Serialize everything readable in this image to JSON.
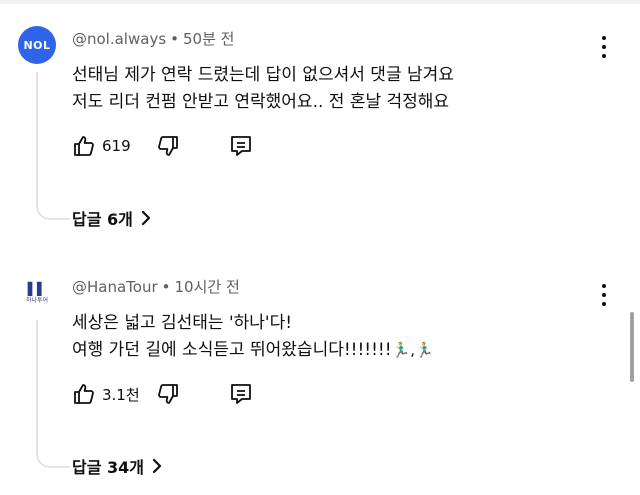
{
  "comments": [
    {
      "avatar_text": "NOL",
      "author": "@nol.always",
      "time": "50분 전",
      "separator": "•",
      "lines": [
        "선태님 제가 연락 드렸는데 답이 없으셔서 댓글 남겨요",
        "저도 리더 컨펌 안받고 연락했어요.. 전 혼날 걱정해요"
      ],
      "likes": "619",
      "replies": "답글 6개"
    },
    {
      "avatar_text": "하나투어",
      "author": "@HanaTour",
      "time": "10시간 전",
      "separator": "•",
      "lines": [
        "세상은 넓고 김선태는 '하나'다!",
        "여행 가던 길에 소식듣고 뛰어왔습니다!!!!!!!"
      ],
      "emoji": "🏃🏼‍♂️,🏃🏼‍♂️",
      "likes": "3.1천",
      "replies": "답글 34개"
    }
  ],
  "icons": {
    "like": "thumb-up-icon",
    "dislike": "thumb-down-icon",
    "reply": "comment-icon",
    "more": "more-vertical-icon",
    "chevron": "chevron-right-icon"
  },
  "colors": {
    "nol_brand": "#2f63e8",
    "hana_brand": "#2b3a8f",
    "meta_text": "#606060"
  }
}
